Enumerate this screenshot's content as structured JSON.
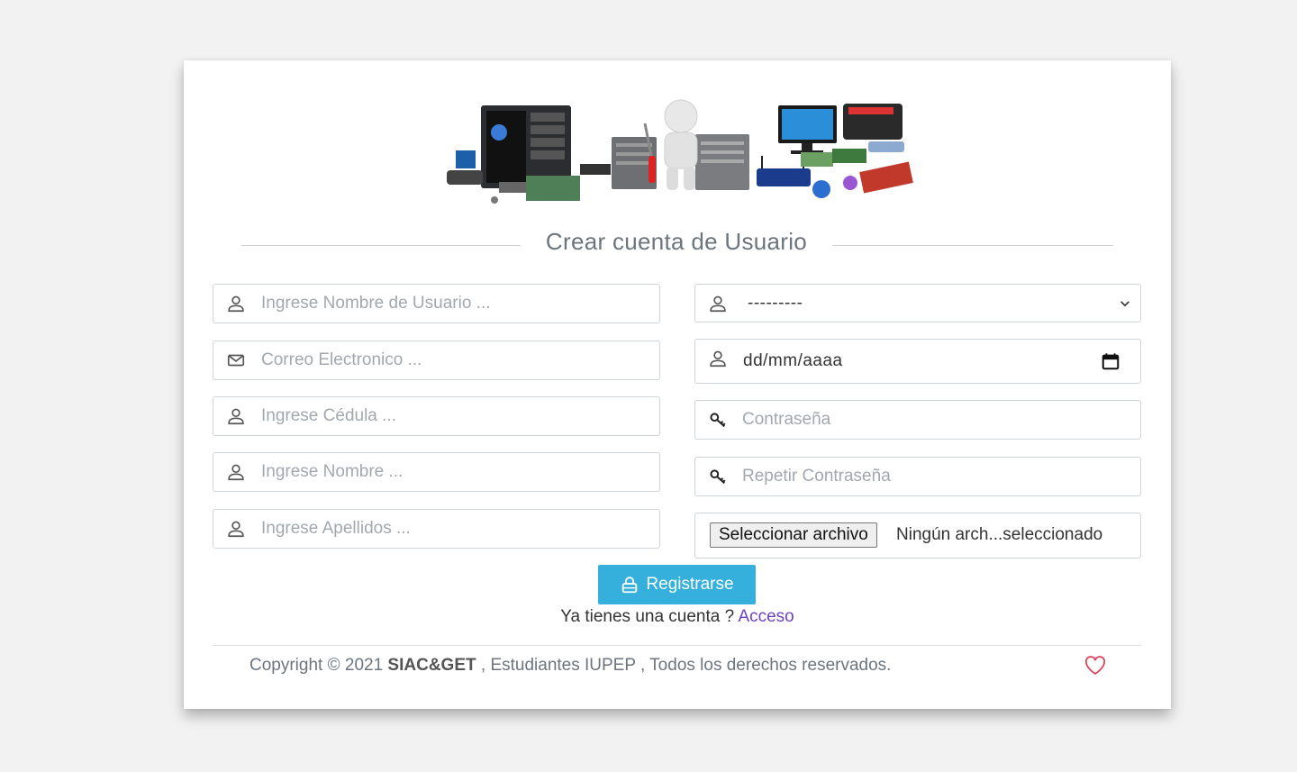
{
  "header": {
    "title": "Crear cuenta de Usuario"
  },
  "form": {
    "left": [
      {
        "icon": "user-icon",
        "placeholder": "Ingrese Nombre de Usuario ..."
      },
      {
        "icon": "envelope-icon",
        "placeholder": "Correo Electronico ..."
      },
      {
        "icon": "user-icon",
        "placeholder": "Ingrese Cédula ..."
      },
      {
        "icon": "user-icon",
        "placeholder": "Ingrese Nombre ..."
      },
      {
        "icon": "user-icon",
        "placeholder": "Ingrese Apellidos ..."
      }
    ],
    "right": {
      "select": {
        "icon": "user-icon",
        "value": "---------"
      },
      "date": {
        "icon": "user-icon",
        "value": "dd/mm/aaaa"
      },
      "password": {
        "icon": "key-icon",
        "placeholder": "Contraseña"
      },
      "password_repeat": {
        "icon": "key-icon",
        "placeholder": "Repetir Contraseña"
      },
      "file": {
        "button_label": "Seleccionar archivo",
        "status": "Ningún arch...seleccionado"
      }
    }
  },
  "register_button": {
    "label": "Registrarse",
    "icon": "lock-icon"
  },
  "account": {
    "text": "Ya tienes una cuenta ?",
    "link": "Acceso"
  },
  "footer": {
    "prefix": "Copyright © 2021",
    "brand": "SIAC&GET",
    "suffix": ", Estudiantes IUPEP , Todos los derechos reservados.",
    "icon": "heart-icon"
  },
  "colors": {
    "page_bg": "#f2f2f2",
    "button_bg": "#35b0dc",
    "link": "#6f42c1",
    "heart": "#e0455a"
  }
}
